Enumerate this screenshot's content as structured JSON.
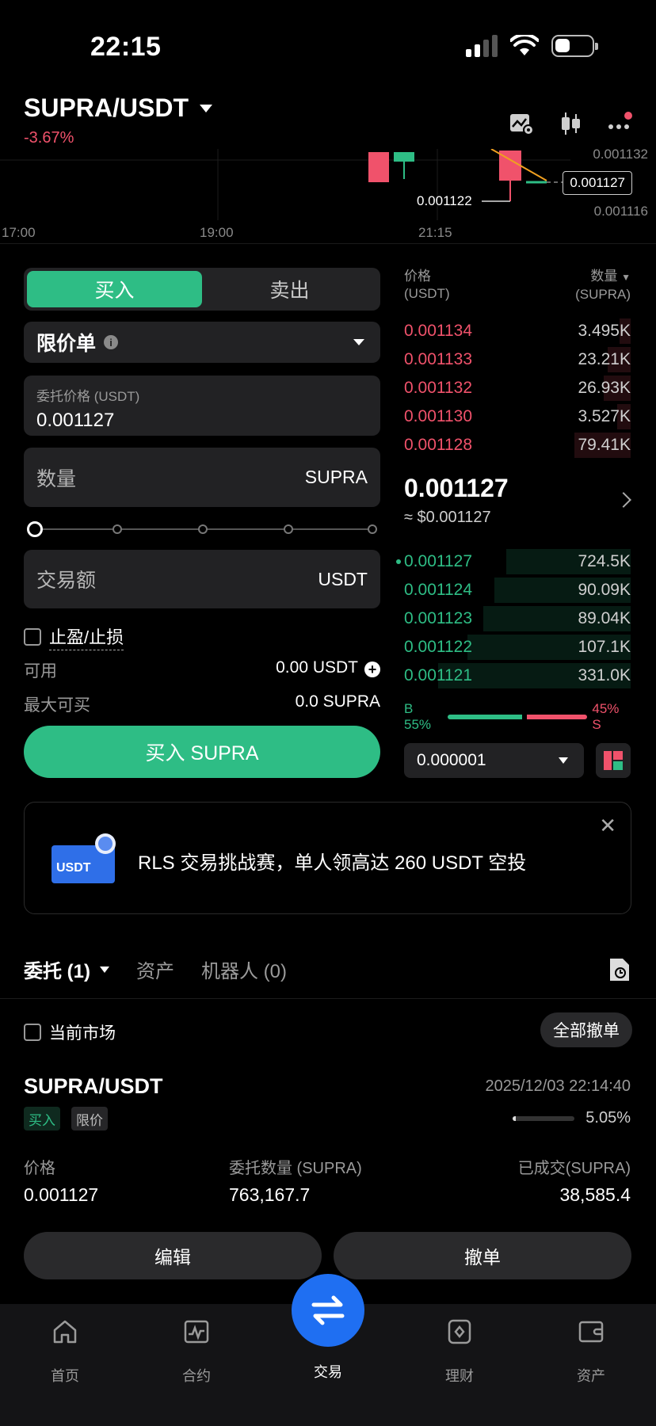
{
  "status_bar": {
    "time": "22:15"
  },
  "header": {
    "pair": "SUPRA/USDT",
    "change": "-3.67%",
    "icons": [
      "chart-settings-icon",
      "candlestick-icon",
      "more-icon"
    ]
  },
  "chart": {
    "time_labels": [
      "17:00",
      "19:00",
      "21:15"
    ],
    "price_labels": [
      "0.001132",
      "0.001116"
    ],
    "current_price_tag": "0.001127",
    "low_marker": "0.001122"
  },
  "trade": {
    "tab_buy": "买入",
    "tab_sell": "卖出",
    "order_type": "限价单",
    "price_label": "委托价格 (USDT)",
    "price_value": "0.001127",
    "qty_label": "数量",
    "qty_unit": "SUPRA",
    "amount_label": "交易额",
    "amount_unit": "USDT",
    "tpsl_label": "止盈/止损",
    "available_label": "可用",
    "available_value": "0.00 USDT",
    "max_buy_label": "最大可买",
    "max_buy_value": "0.0 SUPRA",
    "buy_button": "买入 SUPRA",
    "colors": {
      "buy": "#2ebd85",
      "sell": "#f0526b"
    }
  },
  "orderbook": {
    "price_header": "价格",
    "price_unit": "(USDT)",
    "qty_header": "数量",
    "qty_unit": "(SUPRA)",
    "asks": [
      {
        "price": "0.001134",
        "qty": "3.495K",
        "depth": 0.05
      },
      {
        "price": "0.001133",
        "qty": "23.21K",
        "depth": 0.1
      },
      {
        "price": "0.001132",
        "qty": "26.93K",
        "depth": 0.12
      },
      {
        "price": "0.001130",
        "qty": "3.527K",
        "depth": 0.06
      },
      {
        "price": "0.001128",
        "qty": "79.41K",
        "depth": 0.25
      }
    ],
    "mid_price": "0.001127",
    "mid_usd": "≈ $0.001127",
    "bids": [
      {
        "price": "0.001127",
        "qty": "724.5K",
        "depth": 0.55
      },
      {
        "price": "0.001124",
        "qty": "90.09K",
        "depth": 0.6
      },
      {
        "price": "0.001123",
        "qty": "89.04K",
        "depth": 0.65
      },
      {
        "price": "0.001122",
        "qty": "107.1K",
        "depth": 0.72
      },
      {
        "price": "0.001121",
        "qty": "331.0K",
        "depth": 0.85
      }
    ],
    "buy_ratio_label": "B 55%",
    "sell_ratio_label": "45% S",
    "buy_ratio": 0.55,
    "precision": "0.000001"
  },
  "promo": {
    "badge": "USDT",
    "text": "RLS 交易挑战赛，单人领高达 260 USDT 空投"
  },
  "orders_section": {
    "tab_orders": "委托 (1)",
    "tab_assets": "资产",
    "tab_bots": "机器人 (0)",
    "current_market": "当前市场",
    "cancel_all": "全部撤单",
    "order": {
      "pair": "SUPRA/USDT",
      "time": "2025/12/03 22:14:40",
      "side_tag": "买入",
      "type_tag": "限价",
      "fill_percent_text": "5.05%",
      "fill_fraction": 0.0505,
      "price_label": "价格",
      "price": "0.001127",
      "qty_label": "委托数量 (SUPRA)",
      "qty": "763,167.7",
      "filled_label": "已成交(SUPRA)",
      "filled": "38,585.4",
      "edit": "编辑",
      "cancel": "撤单"
    }
  },
  "nav": {
    "items": [
      {
        "label": "首页",
        "icon": "home-icon"
      },
      {
        "label": "合约",
        "icon": "futures-icon"
      },
      {
        "label": "交易",
        "icon": "trade-icon"
      },
      {
        "label": "理财",
        "icon": "earn-icon"
      },
      {
        "label": "资产",
        "icon": "assets-icon"
      }
    ],
    "active": "交易"
  }
}
